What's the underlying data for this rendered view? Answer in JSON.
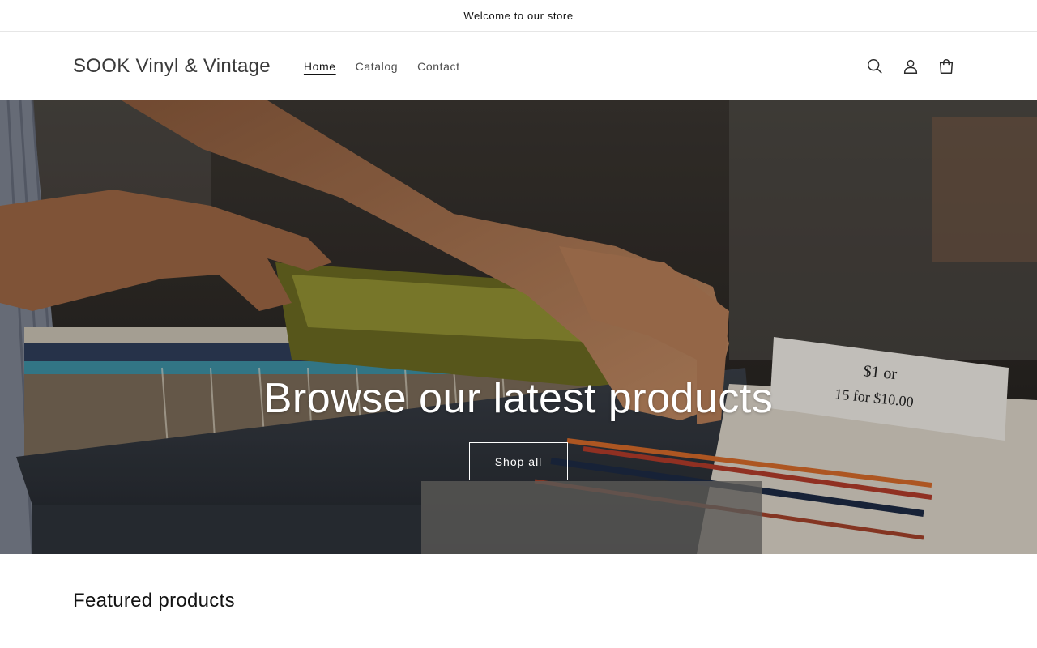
{
  "announcement": {
    "text": "Welcome to our store"
  },
  "header": {
    "logo": "SOOK Vinyl & Vintage",
    "nav": [
      {
        "label": "Home",
        "active": true
      },
      {
        "label": "Catalog",
        "active": false
      },
      {
        "label": "Contact",
        "active": false
      }
    ],
    "icons": [
      "search-icon",
      "account-icon",
      "cart-icon"
    ]
  },
  "hero": {
    "title": "Browse our latest products",
    "button_label": "Shop all",
    "sign_text_1": "$1 or",
    "sign_text_2": "15 for $10.00"
  },
  "featured": {
    "title": "Featured products"
  },
  "colors": {
    "text": "#121212",
    "hero_text": "#ffffff",
    "border": "#e6e6e6"
  }
}
